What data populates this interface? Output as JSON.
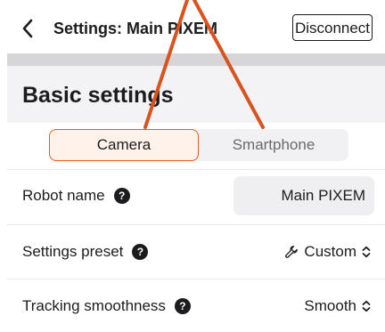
{
  "header": {
    "back_label": "<",
    "title": "Settings: Main PIXEM",
    "disconnect_label": "Disconnect"
  },
  "section": {
    "title": "Basic settings"
  },
  "tabs": {
    "camera": "Camera",
    "smartphone": "Smartphone",
    "selected": "Camera"
  },
  "rows": {
    "robot_name": {
      "label": "Robot name",
      "value": "Main PIXEM"
    },
    "settings_preset": {
      "label": "Settings preset",
      "value": "Custom"
    },
    "tracking_smoothness": {
      "label": "Tracking smoothness",
      "value": "Smooth"
    }
  },
  "colors": {
    "accent": "#e85a1f",
    "annotation_arrow": "#d9531e",
    "section_band": "#f3f3f5",
    "divider_bar": "#d6d6d8"
  },
  "icons": {
    "back": "chevron-left-icon",
    "help": "question-circle-icon",
    "preset": "wrench-icon",
    "select": "chevron-up-down-icon"
  }
}
